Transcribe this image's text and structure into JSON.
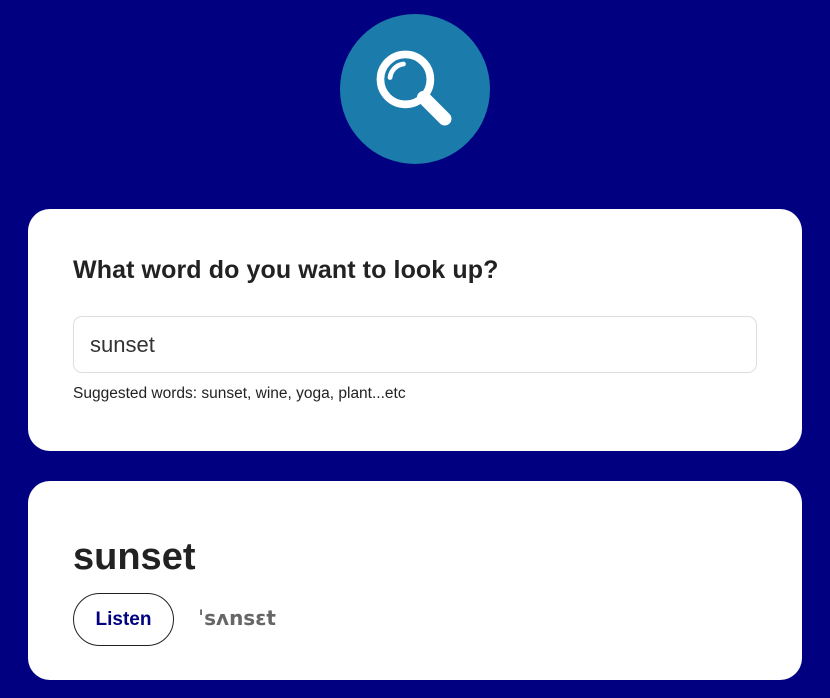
{
  "logo": {
    "icon": "search-icon",
    "background_color": "#1b7bab"
  },
  "search": {
    "heading": "What word do you want to look up?",
    "input_value": "sunset",
    "suggestions": "Suggested words: sunset, wine, yoga, plant...etc"
  },
  "result": {
    "word": "sunset",
    "listen_label": "Listen",
    "phonetic": "ˈsʌnsɛt"
  },
  "colors": {
    "page_background": "#000080",
    "card_background": "#ffffff",
    "accent": "#000080"
  }
}
